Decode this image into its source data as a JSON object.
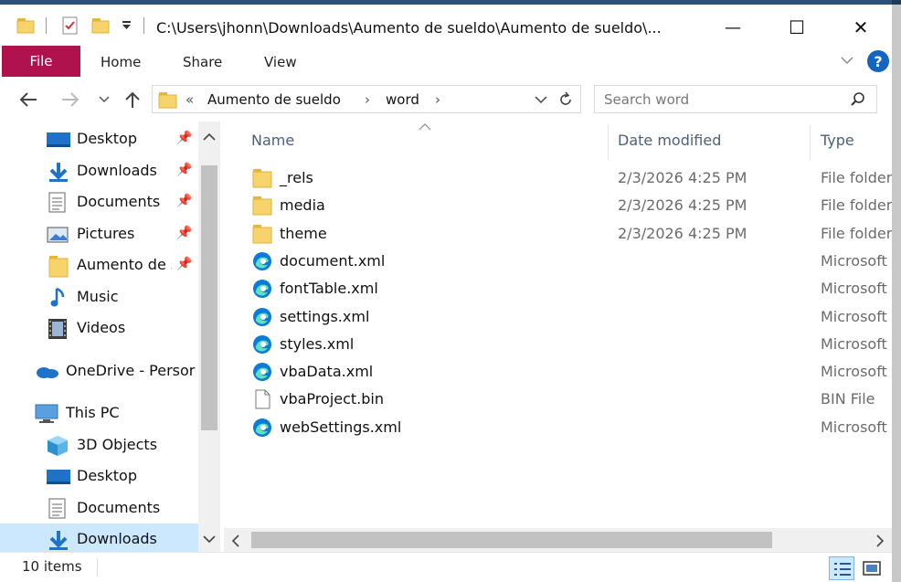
{
  "window": {
    "title": "C:\\Users\\jhonn\\Downloads\\Aumento de sueldo\\Aumento de sueldo\\...",
    "minimize_glyph": "—",
    "maximize_glyph": "☐",
    "close_glyph": "✕"
  },
  "ribbon": {
    "tabs": [
      {
        "label": "File"
      },
      {
        "label": "Home"
      },
      {
        "label": "Share"
      },
      {
        "label": "View"
      }
    ],
    "help_label": "?"
  },
  "address": {
    "overflow": "«",
    "segments": [
      "Aumento de sueldo",
      "word"
    ],
    "separator": "›"
  },
  "search": {
    "placeholder": "Search word"
  },
  "sidebar": {
    "items": [
      {
        "label": "Desktop",
        "icon": "desktop-icon",
        "pinned": true
      },
      {
        "label": "Downloads",
        "icon": "downloads-icon",
        "pinned": true
      },
      {
        "label": "Documents",
        "icon": "documents-icon",
        "pinned": true
      },
      {
        "label": "Pictures",
        "icon": "pictures-icon",
        "pinned": true
      },
      {
        "label": "Aumento de s",
        "icon": "folder-icon",
        "pinned": true
      },
      {
        "label": "Music",
        "icon": "music-icon",
        "pinned": false
      },
      {
        "label": "Videos",
        "icon": "videos-icon",
        "pinned": false
      },
      {
        "label": "OneDrive - Persor",
        "icon": "onedrive-icon",
        "pinned": false
      },
      {
        "label": "This PC",
        "icon": "this-pc-icon",
        "pinned": false
      },
      {
        "label": "3D Objects",
        "icon": "3d-objects-icon",
        "pinned": false
      },
      {
        "label": "Desktop",
        "icon": "desktop-icon",
        "pinned": false
      },
      {
        "label": "Documents",
        "icon": "documents-icon",
        "pinned": false
      },
      {
        "label": "Downloads",
        "icon": "downloads-icon",
        "pinned": false,
        "selected": true
      }
    ]
  },
  "columns": {
    "name": "Name",
    "date": "Date modified",
    "type": "Type"
  },
  "files": [
    {
      "name": "_rels",
      "date": "2/3/2026 4:25 PM",
      "type": "File folder",
      "icon": "folder-icon"
    },
    {
      "name": "media",
      "date": "2/3/2026 4:25 PM",
      "type": "File folder",
      "icon": "folder-icon"
    },
    {
      "name": "theme",
      "date": "2/3/2026 4:25 PM",
      "type": "File folder",
      "icon": "folder-icon"
    },
    {
      "name": "document.xml",
      "date": "",
      "type": "Microsoft",
      "icon": "edge-icon"
    },
    {
      "name": "fontTable.xml",
      "date": "",
      "type": "Microsoft",
      "icon": "edge-icon"
    },
    {
      "name": "settings.xml",
      "date": "",
      "type": "Microsoft",
      "icon": "edge-icon"
    },
    {
      "name": "styles.xml",
      "date": "",
      "type": "Microsoft",
      "icon": "edge-icon"
    },
    {
      "name": "vbaData.xml",
      "date": "",
      "type": "Microsoft",
      "icon": "edge-icon"
    },
    {
      "name": "vbaProject.bin",
      "date": "",
      "type": "BIN File",
      "icon": "file-icon"
    },
    {
      "name": "webSettings.xml",
      "date": "",
      "type": "Microsoft",
      "icon": "edge-icon"
    }
  ],
  "status": {
    "count": "10 items"
  },
  "colors": {
    "file_tab": "#b0124e",
    "selection": "#cce8ff",
    "header_text": "#4c607a",
    "help": "#1565c0"
  }
}
